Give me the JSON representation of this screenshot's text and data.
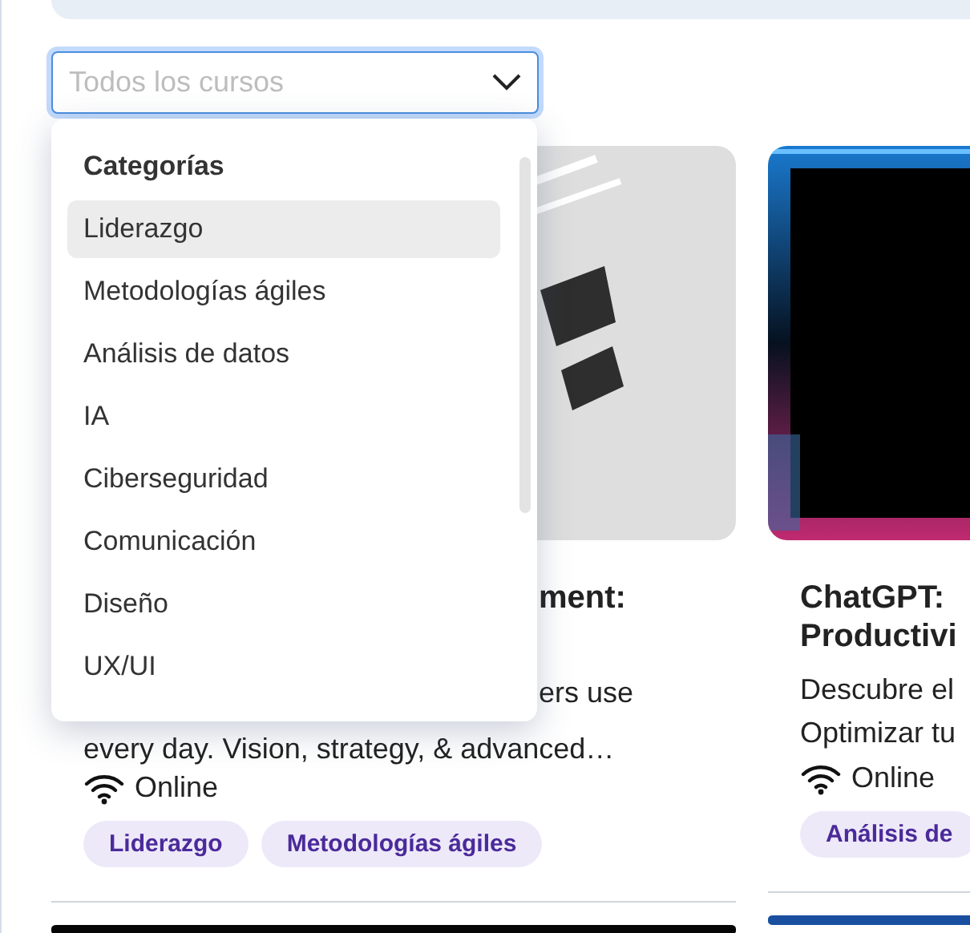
{
  "filter": {
    "placeholder": "Todos los cursos",
    "expanded": true
  },
  "dropdown": {
    "header": "Categorías",
    "items": [
      {
        "label": "Liderazgo",
        "selected": true
      },
      {
        "label": "Metodologías ágiles",
        "selected": false
      },
      {
        "label": "Análisis de datos",
        "selected": false
      },
      {
        "label": "IA",
        "selected": false
      },
      {
        "label": "Ciberseguridad",
        "selected": false
      },
      {
        "label": "Comunicación",
        "selected": false
      },
      {
        "label": "Diseño",
        "selected": false
      },
      {
        "label": "UX/UI",
        "selected": false
      }
    ]
  },
  "courses": [
    {
      "kind": "covered",
      "title_lines": [
        "ment:"
      ],
      "description_lines": [
        "ers use",
        "every day. Vision, strategy, & advanced…"
      ],
      "mode": "Online",
      "tags": [
        "Liderazgo",
        "Metodologías ágiles"
      ]
    },
    {
      "kind": "full",
      "title_lines": [
        "ChatGPT:",
        "Productivi"
      ],
      "description_lines": [
        "Descubre el",
        "Optimizar tu"
      ],
      "mode": "Online",
      "tags": [
        "Análisis de"
      ]
    }
  ]
}
